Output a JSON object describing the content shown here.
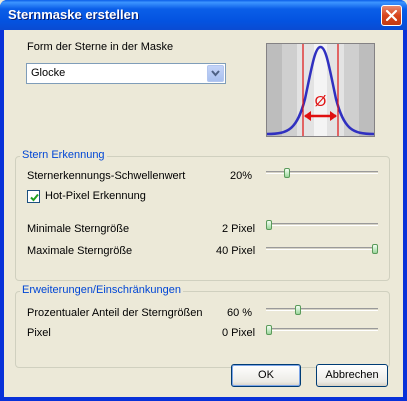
{
  "window": {
    "title": "Sternmaske erstellen"
  },
  "shape": {
    "label": "Form der Sterne in der Maske",
    "selected": "Glocke",
    "preview_symbol": "Ø"
  },
  "detection": {
    "group_title": "Stern Erkennung",
    "threshold": {
      "label": "Sternerkennungs-Schwellenwert",
      "value_text": "20%",
      "value": 20
    },
    "hot_pixel": {
      "label": "Hot-Pixel Erkennung",
      "checked": true
    },
    "min_size": {
      "label": "Minimale Sterngröße",
      "value_text": "2 Pixel",
      "value": 0
    },
    "max_size": {
      "label": "Maximale Sterngröße",
      "value_text": "40 Pixel",
      "value": 100
    }
  },
  "extensions": {
    "group_title": "Erweiterungen/Einschränkungen",
    "percent": {
      "label": "Prozentualer Anteil der Sterngrößen",
      "value_text": "60 %",
      "value": 30
    },
    "pixel": {
      "label": "Pixel",
      "value_text": "0 Pixel",
      "value": 0
    }
  },
  "buttons": {
    "ok": "OK",
    "cancel": "Abbrechen"
  },
  "colors": {
    "accent": "#0046d5",
    "curve": "#3030c0",
    "marker": "#e01010"
  }
}
